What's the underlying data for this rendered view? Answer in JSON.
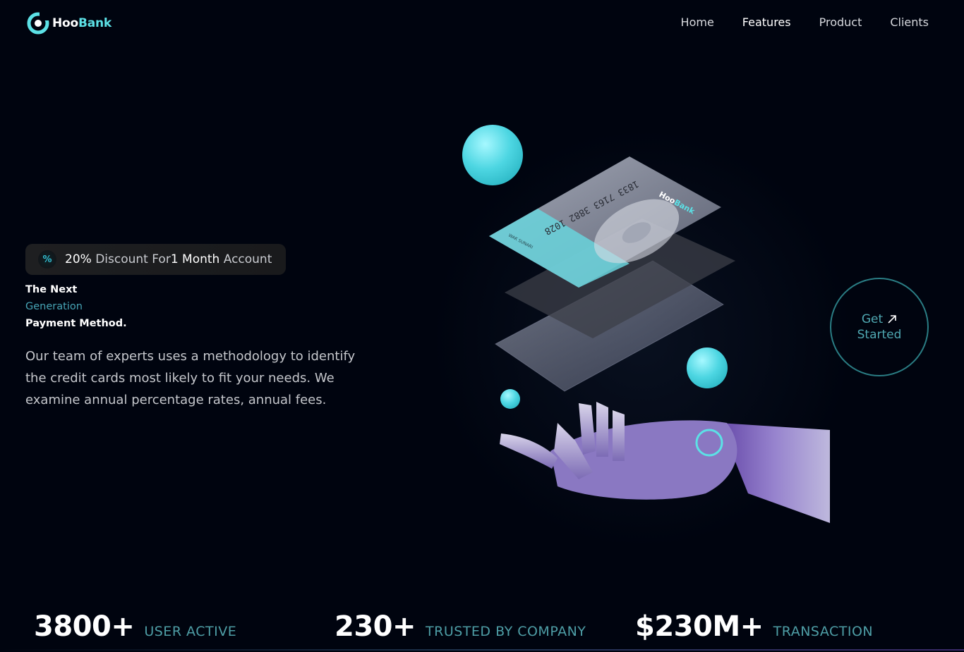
{
  "brand": {
    "name_part1": "Hoo",
    "name_part2": "Bank",
    "accent": "#5ce1e6"
  },
  "nav": {
    "items": [
      {
        "label": "Home"
      },
      {
        "label": "Features"
      },
      {
        "label": "Product"
      },
      {
        "label": "Clients"
      }
    ]
  },
  "badge": {
    "icon": "percent-icon",
    "value": "20%",
    "text1": "Discount",
    "text2": "For",
    "highlight": "1 Month",
    "text3": "Account"
  },
  "hero": {
    "line1": "The Next",
    "line2": "Generation",
    "line3": "Payment Method.",
    "description": "Our team of experts uses a methodology to identify the credit cards most likely to fit your needs. We examine annual percentage rates, annual fees."
  },
  "card": {
    "number": "1833 7163 3882 1028",
    "brand_part1": "Hoo",
    "brand_part2": "Bank",
    "holder": "WAK SUNARI"
  },
  "cta": {
    "line1": "Get",
    "line2": "Started",
    "icon": "arrow-up-right-icon"
  },
  "stats": [
    {
      "value": "3800+",
      "label": "USER ACTIVE"
    },
    {
      "value": "230+",
      "label": "TRUSTED BY COMPANY"
    },
    {
      "value": "$230M+",
      "label": "TRANSACTION"
    }
  ]
}
